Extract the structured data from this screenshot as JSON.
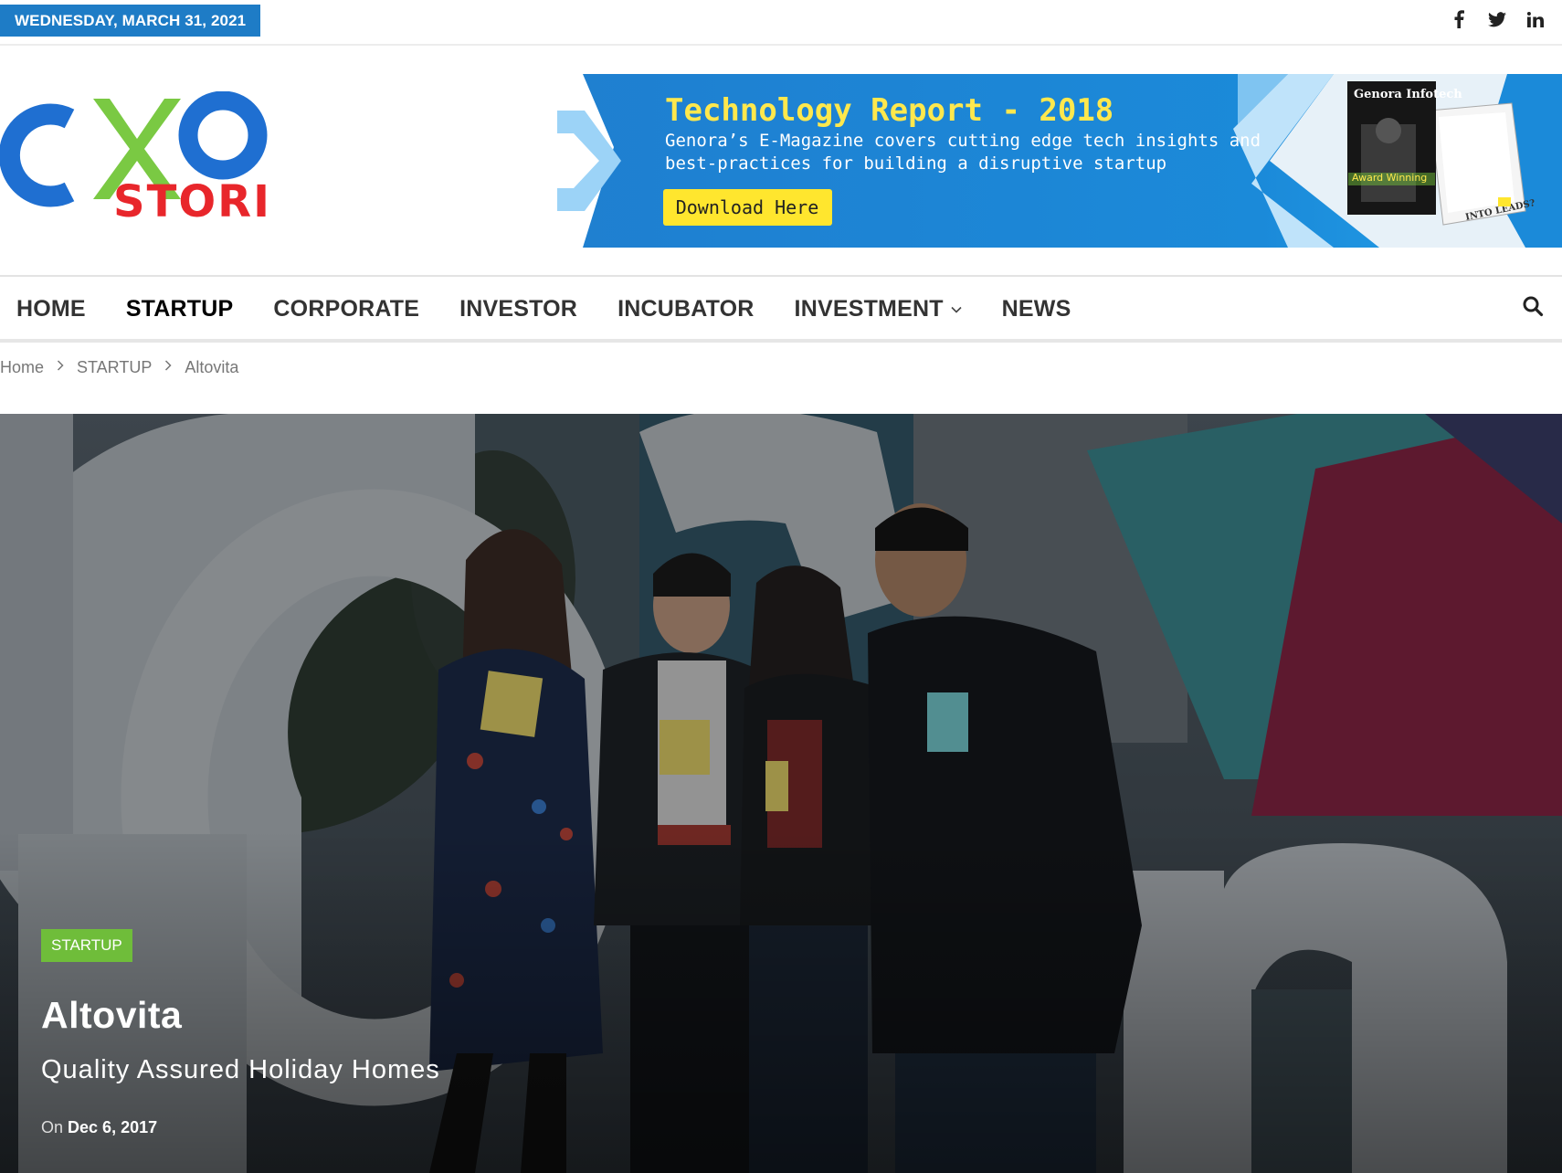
{
  "topbar": {
    "date": "WEDNESDAY, MARCH 31, 2021",
    "social": [
      {
        "icon": "facebook-icon",
        "glyph": "f"
      },
      {
        "icon": "twitter-icon",
        "glyph": "t"
      },
      {
        "icon": "linkedin-icon",
        "glyph": "in"
      }
    ]
  },
  "logo": {
    "mark": "CXO",
    "word": "STORIES",
    "colors": {
      "blue": "#1f6fd1",
      "green": "#7ac943",
      "red": "#e8262b"
    }
  },
  "banner": {
    "title": "Technology Report - 2018",
    "line1": "Genora’s E-Magazine covers cutting edge tech insights and",
    "line2": "best-practices for building a disruptive startup",
    "cta": "Download Here",
    "magazine_title": "Genora Infotech",
    "magazine_tag": "Award Winning",
    "magazine_page": "INTO LEADS?",
    "colors": {
      "bg": "#1a86d6",
      "title": "#ffe84d",
      "cta_bg": "#ffe62e"
    }
  },
  "nav": {
    "items": [
      "HOME",
      "STARTUP",
      "CORPORATE",
      "INVESTOR",
      "INCUBATOR",
      "INVESTMENT",
      "NEWS"
    ],
    "active": "STARTUP",
    "dropdown_item": "INVESTMENT"
  },
  "breadcrumb": [
    "Home",
    "STARTUP",
    "Altovita"
  ],
  "post": {
    "category": "STARTUP",
    "title": "Altovita",
    "subtitle": "Quality Assured Holiday Homes",
    "meta_prefix": "On",
    "date": "Dec 6, 2017",
    "category_color": "#6fbd3a"
  }
}
